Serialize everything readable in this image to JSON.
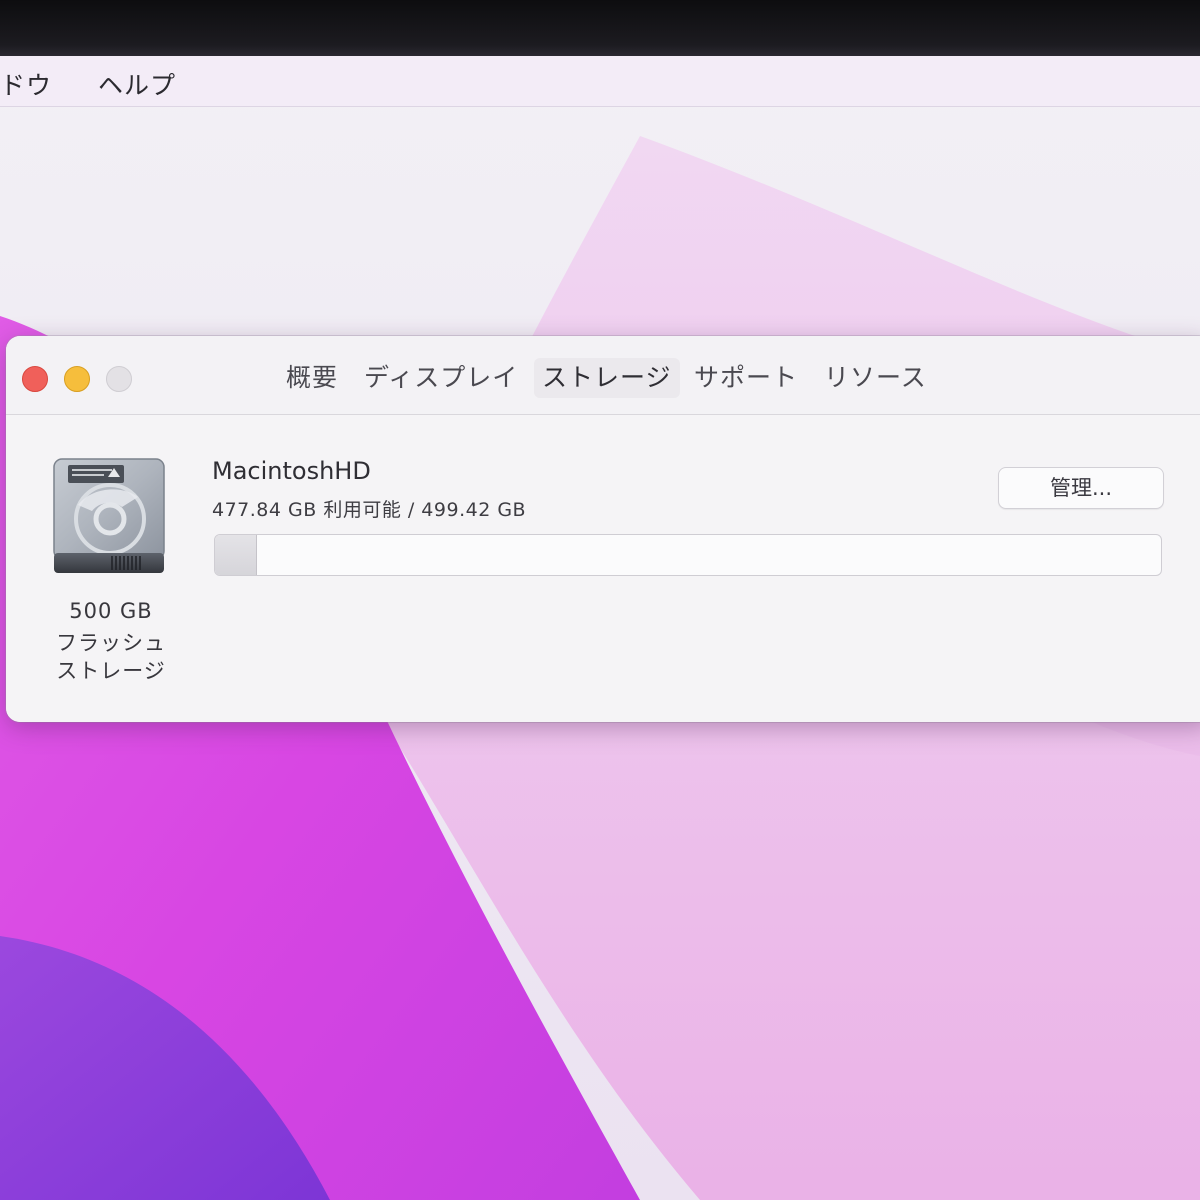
{
  "menubar": {
    "items": [
      "ドウ",
      "ヘルプ"
    ]
  },
  "window": {
    "tabs": [
      {
        "label": "概要",
        "active": false
      },
      {
        "label": "ディスプレイ",
        "active": false
      },
      {
        "label": "ストレージ",
        "active": true
      },
      {
        "label": "サポート",
        "active": false
      },
      {
        "label": "リソース",
        "active": false
      }
    ],
    "storage": {
      "icon": "hard-drive-icon",
      "caption": [
        "500 GB",
        "フラッシュ",
        "ストレージ"
      ],
      "volume_name": "MacintoshHD",
      "capacity_text": "477.84 GB 利用可能 / 499.42 GB",
      "used_fraction": 0.043,
      "manage_label": "管理..."
    }
  },
  "colors": {
    "close": "#f0605a",
    "minimize": "#f6be3c",
    "zoom": "#e3e1e5",
    "wallpaper_magenta": "#d44de0",
    "wallpaper_purple": "#8f3fdc"
  }
}
